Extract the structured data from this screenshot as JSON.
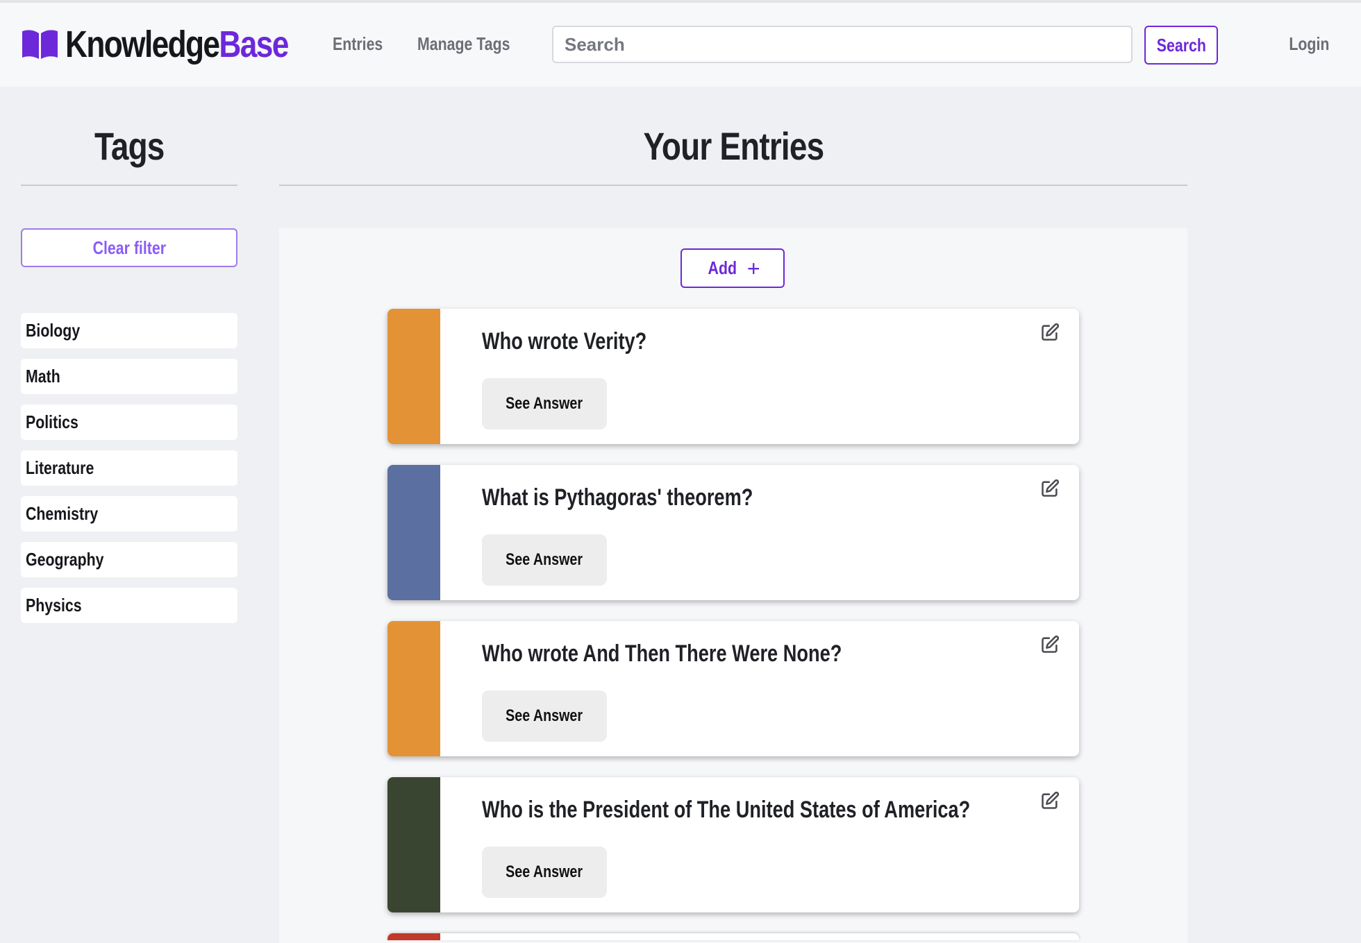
{
  "header": {
    "brand_part1": "Knowledge",
    "brand_part2": "Base",
    "nav": [
      "Entries",
      "Manage Tags"
    ],
    "search_placeholder": "Search",
    "search_button": "Search",
    "login": "Login"
  },
  "sidebar": {
    "title": "Tags",
    "clear_filter": "Clear filter",
    "tags": [
      "Biology",
      "Math",
      "Politics",
      "Literature",
      "Chemistry",
      "Geography",
      "Physics"
    ]
  },
  "main": {
    "title": "Your Entries",
    "add_button": "Add",
    "see_answer_label": "See Answer",
    "entries": [
      {
        "question": "Who wrote Verity?",
        "color": "#e39336"
      },
      {
        "question": "What is Pythagoras' theorem?",
        "color": "#5b6fa0"
      },
      {
        "question": "Who wrote And Then There Were None?",
        "color": "#e39336"
      },
      {
        "question": "Who is the President of The United States of America?",
        "color": "#3a4531"
      }
    ],
    "partial_entry_color": "#c0392b"
  },
  "colors": {
    "accent": "#6d28d9",
    "accent_light": "#8b5cf6",
    "page_bg": "#eff0f3",
    "navbar_bg": "#f7f8fa"
  },
  "icons": {
    "brand": "open-book-icon",
    "edit": "edit-icon",
    "add": "plus-icon"
  }
}
